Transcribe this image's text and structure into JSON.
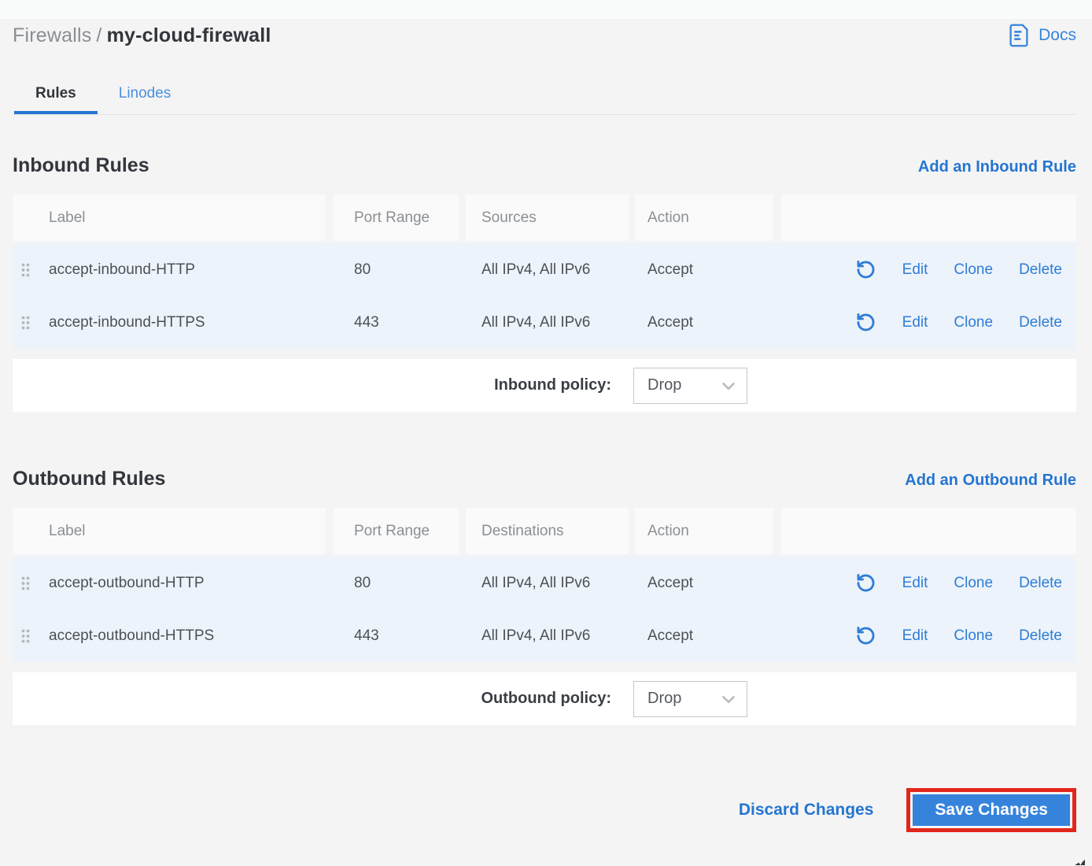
{
  "header": {
    "breadcrumb_section": "Firewalls",
    "breadcrumb_separator": "/",
    "breadcrumb_current": "my-cloud-firewall",
    "docs_label": "Docs"
  },
  "tabs": {
    "rules": "Rules",
    "linodes": "Linodes"
  },
  "row_actions": {
    "edit": "Edit",
    "clone": "Clone",
    "delete": "Delete"
  },
  "inbound": {
    "title": "Inbound Rules",
    "add_label": "Add an Inbound Rule",
    "columns": {
      "label": "Label",
      "port": "Port Range",
      "addresses": "Sources",
      "action": "Action"
    },
    "rows": [
      {
        "label": "accept-inbound-HTTP",
        "port": "80",
        "addresses": "All IPv4, All IPv6",
        "action": "Accept"
      },
      {
        "label": "accept-inbound-HTTPS",
        "port": "443",
        "addresses": "All IPv4, All IPv6",
        "action": "Accept"
      }
    ],
    "policy_label": "Inbound policy:",
    "policy_value": "Drop"
  },
  "outbound": {
    "title": "Outbound Rules",
    "add_label": "Add an Outbound Rule",
    "columns": {
      "label": "Label",
      "port": "Port Range",
      "addresses": "Destinations",
      "action": "Action"
    },
    "rows": [
      {
        "label": "accept-outbound-HTTP",
        "port": "80",
        "addresses": "All IPv4, All IPv6",
        "action": "Accept"
      },
      {
        "label": "accept-outbound-HTTPS",
        "port": "443",
        "addresses": "All IPv4, All IPv6",
        "action": "Accept"
      }
    ],
    "policy_label": "Outbound policy:",
    "policy_value": "Drop"
  },
  "footer": {
    "discard_label": "Discard Changes",
    "save_label": "Save Changes"
  },
  "colors": {
    "link_blue": "#2e7dd6",
    "accent_blue": "#2575d0",
    "button_blue": "#3683dc",
    "highlight_red": "#e2261a",
    "row_blue": "#edf3fa",
    "page_bg": "#f4f4f5"
  }
}
